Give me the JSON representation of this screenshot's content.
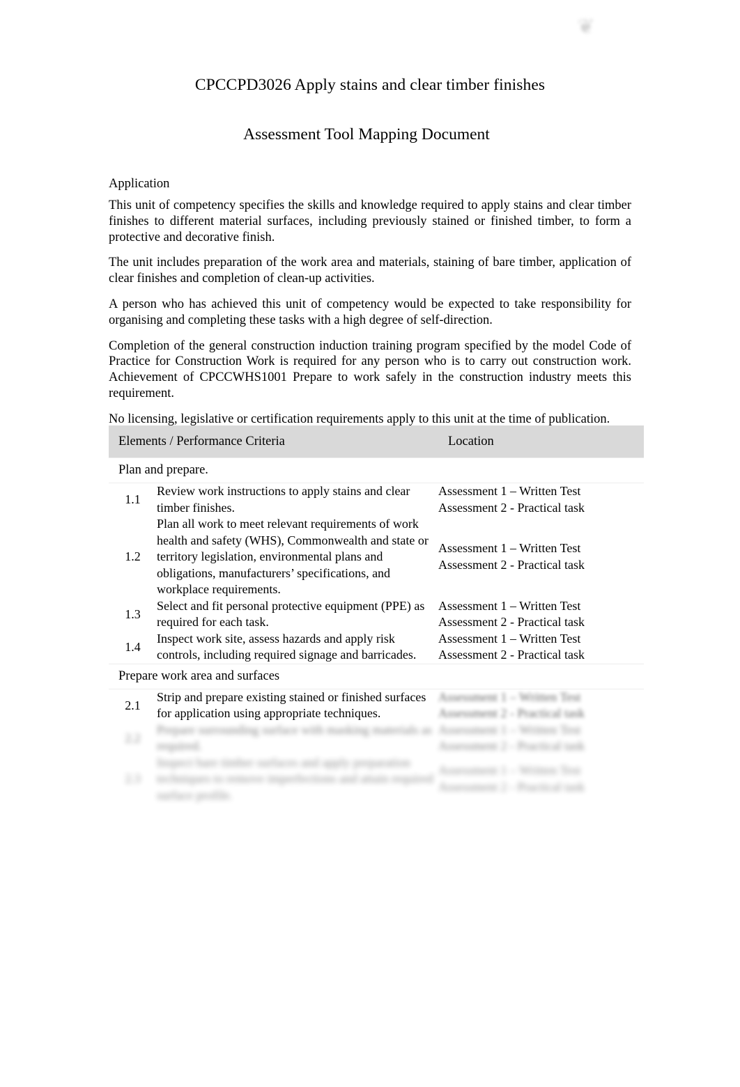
{
  "logo": {
    "mark_glyph": "❦",
    "wordmark": "",
    "name": "organisation-logo"
  },
  "document": {
    "title": "CPCCPD3026 Apply stains and clear timber finishes",
    "subtitle": "Assessment Tool Mapping Document"
  },
  "application": {
    "heading": "Application",
    "paragraphs": [
      "This unit of competency specifies the skills and knowledge required to apply stains and clear timber finishes to different material surfaces, including previously stained or finished timber, to form a protective and decorative finish.",
      "The unit includes preparation of the work area and materials, staining of bare timber, application of clear finishes and completion of clean-up activities.",
      "A person who has achieved this unit of competency would be expected to take responsibility for organising and completing these tasks with a high degree of self-direction.",
      "Completion of the general construction induction training program specified by the model Code of Practice for Construction Work is required for any person who is to carry out construction work. Achievement of CPCCWHS1001 Prepare to work safely in the construction industry meets this requirement.",
      "No licensing, legislative or certification requirements apply to this unit at the time of publication."
    ]
  },
  "table": {
    "headers": {
      "criteria": "Elements / Performance Criteria",
      "location": "Location"
    },
    "location_lines": {
      "line1": "Assessment 1 – Written Test",
      "line2": "Assessment 2 - Practical task"
    },
    "groups": [
      {
        "title": "Plan and prepare.",
        "rows": [
          {
            "number": "1.1",
            "criteria": "Review work instructions to apply stains and clear timber finishes.",
            "location_line1": "Assessment 1 – Written Test",
            "location_line2": "Assessment 2 - Practical task"
          },
          {
            "number": "1.2",
            "criteria": "Plan all work to meet relevant requirements of work health and safety (WHS), Commonwealth and state or territory legislation, environmental plans and obligations, manufacturers’ specifications, and workplace requirements.",
            "location_line1": "Assessment 1 – Written Test",
            "location_line2": "Assessment 2 - Practical task"
          },
          {
            "number": "1.3",
            "criteria": "Select and fit personal protective equipment (PPE) as required for each task.",
            "location_line1": "Assessment 1 – Written Test",
            "location_line2": "Assessment 2 - Practical task"
          },
          {
            "number": "1.4",
            "criteria": "Inspect work site, assess hazards and apply risk controls, including required signage and barricades.",
            "location_line1": "Assessment 1 – Written Test",
            "location_line2": "Assessment 2 - Practical task"
          }
        ]
      },
      {
        "title": "Prepare work area and surfaces",
        "rows": [
          {
            "number": "2.1",
            "criteria": "Strip and prepare existing stained or finished surfaces for application using appropriate techniques.",
            "location_line1": "Assessment 1 – Written Test",
            "location_line2": "Assessment 2 - Practical task",
            "blur": "blur-1"
          },
          {
            "number": "2.2",
            "criteria": "Prepare surrounding surface with masking materials as required.",
            "location_line1": "Assessment 1 – Written Test",
            "location_line2": "Assessment 2 - Practical task",
            "blur": "blur-2"
          },
          {
            "number": "2.3",
            "criteria": "Inspect bare timber surfaces and apply preparation techniques to remove imperfections and attain required surface profile.",
            "location_line1": "Assessment 1 – Written Test",
            "location_line2": "Assessment 2 - Practical task",
            "blur": "blur-3"
          }
        ]
      }
    ]
  }
}
